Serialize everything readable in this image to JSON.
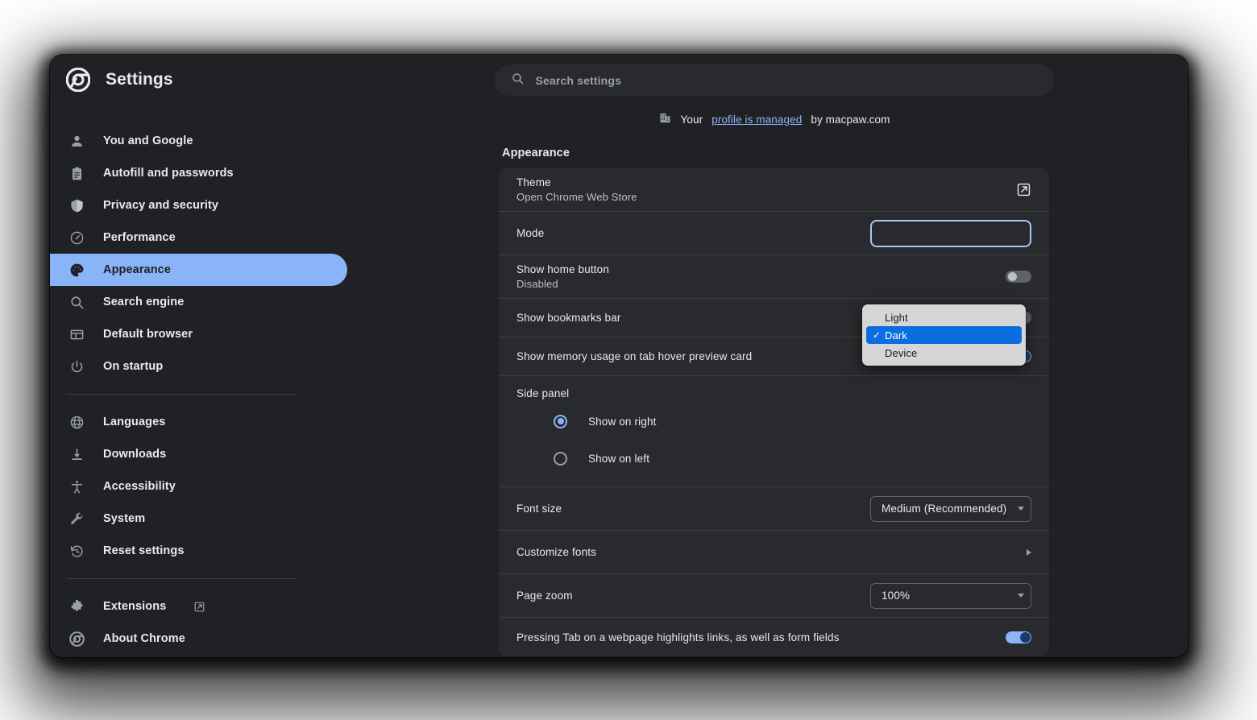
{
  "app": {
    "title": "Settings",
    "logo_icon": "chrome-logo-icon"
  },
  "search": {
    "placeholder": "Search settings",
    "icon": "search-icon"
  },
  "managed_notice": {
    "icon": "building-icon",
    "prefix": "Your",
    "link": "profile is managed",
    "suffix": "by macpaw.com"
  },
  "sidebar": {
    "items": [
      {
        "label": "You and Google",
        "icon": "person-icon",
        "selected": false
      },
      {
        "label": "Autofill and passwords",
        "icon": "clipboard-icon",
        "selected": false
      },
      {
        "label": "Privacy and security",
        "icon": "shield-icon",
        "selected": false
      },
      {
        "label": "Performance",
        "icon": "speedometer-icon",
        "selected": false
      },
      {
        "label": "Appearance",
        "icon": "palette-icon",
        "selected": true
      },
      {
        "label": "Search engine",
        "icon": "search-icon",
        "selected": false
      },
      {
        "label": "Default browser",
        "icon": "browser-window-icon",
        "selected": false
      },
      {
        "label": "On startup",
        "icon": "power-icon",
        "selected": false
      },
      {
        "label": "Languages",
        "icon": "globe-icon",
        "selected": false
      },
      {
        "label": "Downloads",
        "icon": "download-icon",
        "selected": false
      },
      {
        "label": "Accessibility",
        "icon": "accessibility-icon",
        "selected": false
      },
      {
        "label": "System",
        "icon": "wrench-icon",
        "selected": false
      },
      {
        "label": "Reset settings",
        "icon": "history-restore-icon",
        "selected": false
      },
      {
        "label": "Extensions",
        "icon": "puzzle-icon",
        "selected": false,
        "external": true
      },
      {
        "label": "About Chrome",
        "icon": "chrome-logo-icon",
        "selected": false
      }
    ]
  },
  "main": {
    "section_title": "Appearance",
    "rows": {
      "theme": {
        "label": "Theme",
        "sublabel": "Open Chrome Web Store",
        "action_icon": "external-link-icon"
      },
      "mode": {
        "label": "Mode",
        "value": "Dark",
        "options": [
          "Light",
          "Dark",
          "Device"
        ]
      },
      "home_button": {
        "label": "Show home button",
        "sublabel": "Disabled",
        "toggle": "off"
      },
      "bookmarks_bar": {
        "label": "Show bookmarks bar",
        "toggle": "off"
      },
      "memory_usage": {
        "label": "Show memory usage on tab hover preview card",
        "toggle": "on"
      },
      "side_panel": {
        "label": "Side panel",
        "options": [
          {
            "label": "Show on right",
            "checked": true
          },
          {
            "label": "Show on left",
            "checked": false
          }
        ]
      },
      "font_size": {
        "label": "Font size",
        "value": "Medium (Recommended)"
      },
      "customize_fonts": {
        "label": "Customize fonts",
        "action_icon": "chevron-right-icon"
      },
      "page_zoom": {
        "label": "Page zoom",
        "value": "100%"
      },
      "tab_highlight": {
        "label": "Pressing Tab on a webpage highlights links, as well as form fields",
        "toggle": "on"
      }
    }
  },
  "colors": {
    "page_bg": "#202124",
    "card_bg": "#292a2d",
    "accent": "#8ab4f8",
    "popup_highlight": "#0b6ee0",
    "text_primary": "#e8eaed",
    "text_secondary": "#9aa0a6"
  }
}
